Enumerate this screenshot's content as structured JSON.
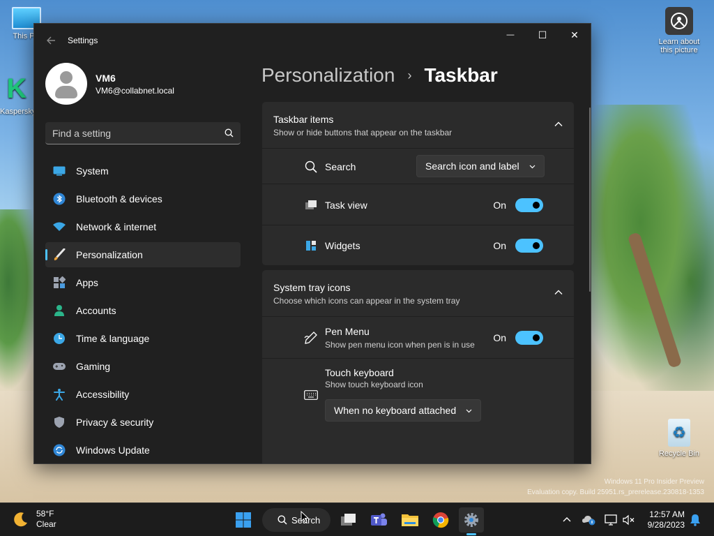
{
  "desktop": {
    "icons": [
      {
        "label": "This PC"
      },
      {
        "label": "Kaspersky Anti-Ransomware"
      },
      {
        "label": "Learn about this picture"
      },
      {
        "label": "Recycle Bin"
      }
    ],
    "watermark_line1": "Windows 11 Pro Insider Preview",
    "watermark_line2": "Evaluation copy. Build 25951.rs_prerelease.230818-1353"
  },
  "window": {
    "title": "Settings",
    "minimize": "—",
    "maximize": "☐",
    "close": "✕"
  },
  "profile": {
    "name": "VM6",
    "email": "VM6@collabnet.local"
  },
  "search": {
    "placeholder": "Find a setting"
  },
  "nav": {
    "items": [
      {
        "label": "System",
        "icon": "monitor-icon"
      },
      {
        "label": "Bluetooth & devices",
        "icon": "bluetooth-icon"
      },
      {
        "label": "Network & internet",
        "icon": "wifi-icon"
      },
      {
        "label": "Personalization",
        "icon": "brush-icon",
        "active": true
      },
      {
        "label": "Apps",
        "icon": "apps-icon"
      },
      {
        "label": "Accounts",
        "icon": "person-icon"
      },
      {
        "label": "Time & language",
        "icon": "globe-clock-icon"
      },
      {
        "label": "Gaming",
        "icon": "gamepad-icon"
      },
      {
        "label": "Accessibility",
        "icon": "accessibility-icon"
      },
      {
        "label": "Privacy & security",
        "icon": "shield-icon"
      },
      {
        "label": "Windows Update",
        "icon": "update-icon"
      }
    ]
  },
  "breadcrumb": {
    "parent": "Personalization",
    "separator": "›",
    "current": "Taskbar"
  },
  "taskbar_items_section": {
    "title": "Taskbar items",
    "subtitle": "Show or hide buttons that appear on the taskbar",
    "search": {
      "label": "Search",
      "dropdown_value": "Search icon and label"
    },
    "task_view": {
      "label": "Task view",
      "state": "On"
    },
    "widgets": {
      "label": "Widgets",
      "state": "On"
    }
  },
  "system_tray_section": {
    "title": "System tray icons",
    "subtitle": "Choose which icons can appear in the system tray",
    "pen_menu": {
      "label": "Pen Menu",
      "sub": "Show pen menu icon when pen is in use",
      "state": "On"
    },
    "touch_keyboard": {
      "label": "Touch keyboard",
      "sub": "Show touch keyboard icon",
      "dropdown_value": "When no keyboard attached"
    }
  },
  "taskbar": {
    "weather_temp": "58°F",
    "weather_desc": "Clear",
    "search_label": "Search",
    "time": "12:57 AM",
    "date": "9/28/2023"
  }
}
